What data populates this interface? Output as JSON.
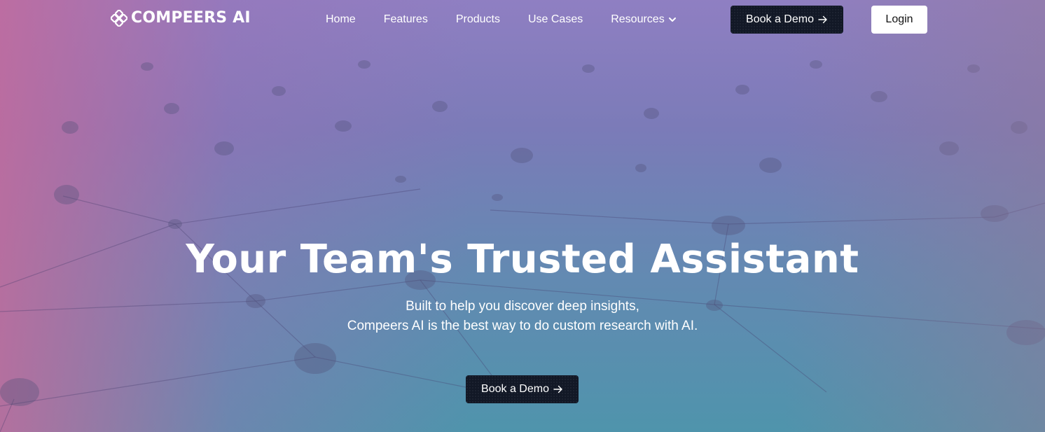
{
  "nav": {
    "logo_text": "COMPEERS AI",
    "logo_icon": "compeers-logo-icon",
    "links": [
      {
        "label": "Home"
      },
      {
        "label": "Features"
      },
      {
        "label": "Products"
      },
      {
        "label": "Use Cases"
      },
      {
        "label": "Resources",
        "icon": "chevron-down-icon"
      }
    ],
    "demo_button": {
      "label": "Book a Demo",
      "icon": "arrow-right-icon"
    },
    "login_button": {
      "label": "Login"
    }
  },
  "hero": {
    "title": "Your Team's Trusted Assistant",
    "subtitle_line1": "Built to help you discover deep insights,",
    "subtitle_line2": "Compeers AI is the best way to do custom research with AI.",
    "cta": {
      "label": "Book a Demo",
      "icon": "arrow-right-icon"
    }
  },
  "colors": {
    "dark_button": "#121826",
    "login_button": "#ffffff",
    "text": "#ffffff",
    "bg_top": "#8f7fc2",
    "bg_bottom": "#4f94ac",
    "bg_left_tint": "#c46a9c"
  }
}
